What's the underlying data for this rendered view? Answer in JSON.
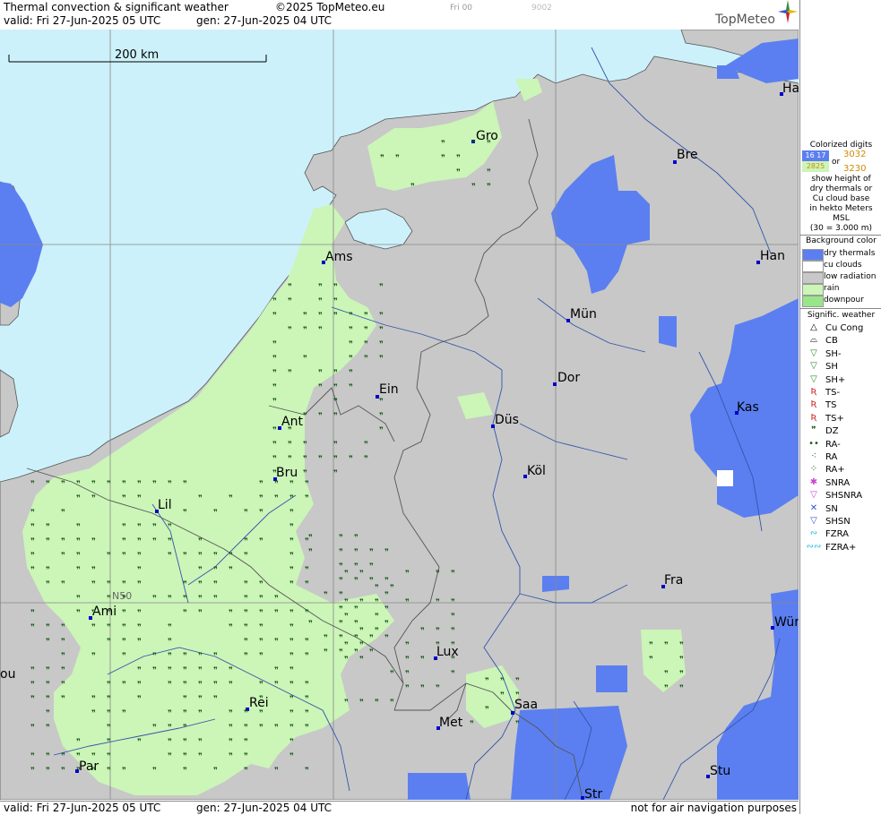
{
  "header": {
    "title": "Thermal convection & significant weather",
    "copyright": "©2025 TopMeteo.eu",
    "valid": "valid:  Fri  27-Jun-2025  05 UTC",
    "gen": "gen: 27-Jun-2025 04 UTC",
    "day_code": "Fri 00",
    "num_code": "9002",
    "logo": "TopMeteo"
  },
  "scale": {
    "label": "200 km"
  },
  "grid_label": "N50",
  "cities": [
    {
      "name": "Gro"
    },
    {
      "name": "Bre"
    },
    {
      "name": "Ha"
    },
    {
      "name": "Ams"
    },
    {
      "name": "Han"
    },
    {
      "name": "Mün"
    },
    {
      "name": "Ein"
    },
    {
      "name": "Dor"
    },
    {
      "name": "Kas"
    },
    {
      "name": "Ant"
    },
    {
      "name": "Düs"
    },
    {
      "name": "Bru"
    },
    {
      "name": "Köl"
    },
    {
      "name": "Lil"
    },
    {
      "name": "Fra"
    },
    {
      "name": "Ami"
    },
    {
      "name": "Wür"
    },
    {
      "name": "Lux"
    },
    {
      "name": "ou"
    },
    {
      "name": "Rei"
    },
    {
      "name": "Saa"
    },
    {
      "name": "Met"
    },
    {
      "name": "Par"
    },
    {
      "name": "Stu"
    },
    {
      "name": "Str"
    }
  ],
  "footer": {
    "valid": "valid:  Fri  27-Jun-2025  05 UTC",
    "gen": "gen: 27-Jun-2025 04 UTC",
    "note": "not for air navigation purposes"
  },
  "sidebar": {
    "colorized_title": "Colorized digits",
    "digits_a": "16 17",
    "digits_b": "2825",
    "digits_or": "or",
    "digits_c": "3032",
    "digits_d": "3230",
    "desc_lines": [
      "show height of",
      "dry thermals or",
      "Cu cloud base",
      "in hekto Meters",
      "MSL",
      "(30 = 3.000 m)"
    ],
    "bg_title": "Background color",
    "bg_items": [
      {
        "label": "dry thermals",
        "color": "#5b7ff0"
      },
      {
        "label": "cu clouds",
        "color": "#ffffff"
      },
      {
        "label": "low radiation",
        "color": "#c8c8c8"
      },
      {
        "label": "rain",
        "color": "#ccf5b8"
      },
      {
        "label": "downpour",
        "color": "#99e68a"
      }
    ],
    "sig_title": "Signific. weather",
    "sig_items": [
      {
        "label": "Cu Cong",
        "icon": "cu-cong-icon",
        "symbol": "△",
        "color": "#000000"
      },
      {
        "label": "CB",
        "icon": "cb-icon",
        "symbol": "⌓",
        "color": "#000000"
      },
      {
        "label": "SH-",
        "icon": "shower-light-icon",
        "symbol": "▽",
        "color": "#2e8b2e"
      },
      {
        "label": "SH",
        "icon": "shower-icon",
        "symbol": "▽",
        "color": "#2e8b2e"
      },
      {
        "label": "SH+",
        "icon": "shower-heavy-icon",
        "symbol": "▽",
        "color": "#2e8b2e"
      },
      {
        "label": "TS-",
        "icon": "thunderstorm-light-icon",
        "symbol": "Ʀ",
        "color": "#cc2222"
      },
      {
        "label": "TS",
        "icon": "thunderstorm-icon",
        "symbol": "Ʀ",
        "color": "#cc2222"
      },
      {
        "label": "TS+",
        "icon": "thunderstorm-heavy-icon",
        "symbol": "Ʀ",
        "color": "#cc2222"
      },
      {
        "label": "DZ",
        "icon": "drizzle-icon",
        "symbol": "❞",
        "color": "#1a5c1a"
      },
      {
        "label": "RA-",
        "icon": "rain-light-icon",
        "symbol": "••",
        "color": "#1a5c1a"
      },
      {
        "label": "RA",
        "icon": "rain-icon",
        "symbol": "⁖",
        "color": "#1a5c1a"
      },
      {
        "label": "RA+",
        "icon": "rain-heavy-icon",
        "symbol": "⁘",
        "color": "#1a5c1a"
      },
      {
        "label": "SNRA",
        "icon": "snow-rain-icon",
        "symbol": "✱",
        "color": "#cc44cc"
      },
      {
        "label": "SHSNRA",
        "icon": "snow-rain-shower-icon",
        "symbol": "▽",
        "color": "#cc44cc"
      },
      {
        "label": "SN",
        "icon": "snow-icon",
        "symbol": "✕",
        "color": "#3355cc"
      },
      {
        "label": "SHSN",
        "icon": "snow-shower-icon",
        "symbol": "▽",
        "color": "#3355cc"
      },
      {
        "label": "FZRA",
        "icon": "freezing-rain-icon",
        "symbol": "∾",
        "color": "#22bbdd"
      },
      {
        "label": "FZRA+",
        "icon": "freezing-rain-heavy-icon",
        "symbol": "∾∾",
        "color": "#22bbdd"
      }
    ]
  }
}
